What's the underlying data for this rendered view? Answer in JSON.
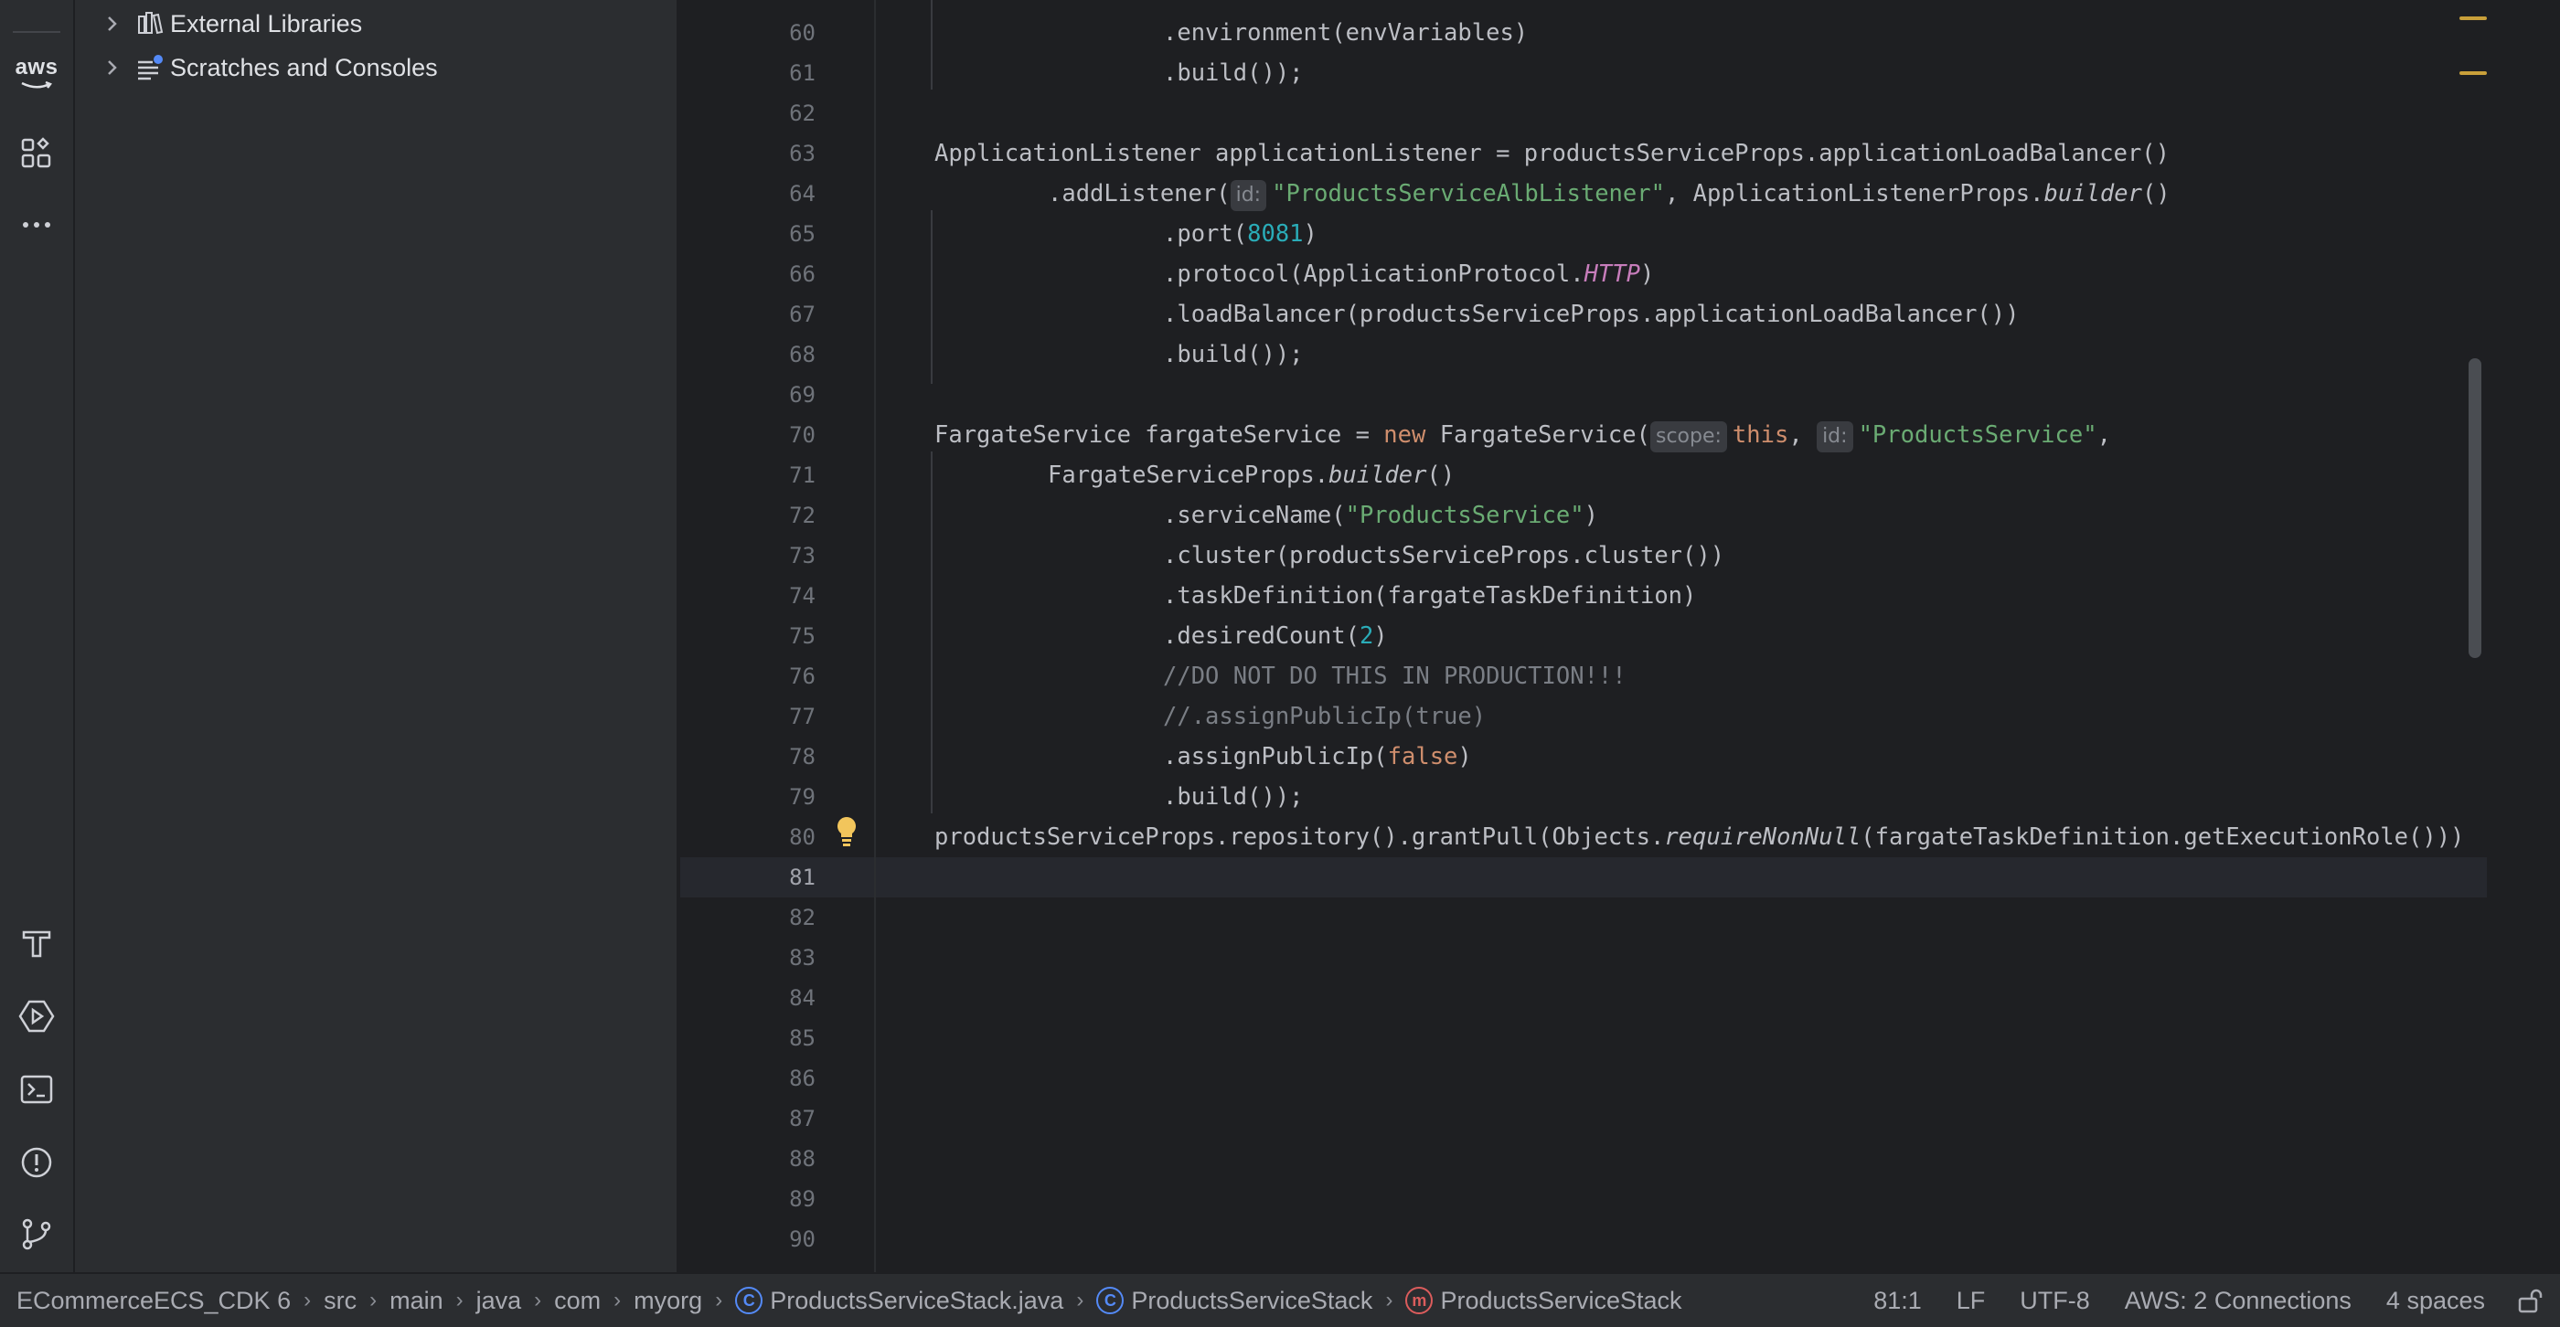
{
  "activity_bar": {
    "aws_label": "aws",
    "top_icons": [
      "structure-icon",
      "more-icon"
    ],
    "bottom_icons": [
      "build-icon",
      "services-icon",
      "terminal-icon",
      "problems-icon",
      "git-icon"
    ]
  },
  "project_tree": {
    "items": [
      {
        "label": "External Libraries",
        "icon": "library-icon"
      },
      {
        "label": "Scratches and Consoles",
        "icon": "scratches-icon"
      }
    ]
  },
  "editor": {
    "current_line": 81,
    "line_numbers": [
      "60",
      "61",
      "62",
      "63",
      "64",
      "65",
      "66",
      "67",
      "68",
      "69",
      "70",
      "71",
      "72",
      "73",
      "74",
      "75",
      "76",
      "77",
      "78",
      "79",
      "80",
      "81",
      "82",
      "83",
      "84",
      "85",
      "86",
      "87",
      "88",
      "89",
      "90"
    ],
    "code": {
      "l60": ".environment(envVariables)",
      "l61": ".build());",
      "l63": "ApplicationListener applicationListener = productsServiceProps.applicationLoadBalancer()",
      "l64_a": ".addListener(",
      "l64_hint": "id:",
      "l64_str": "\"ProductsServiceAlbListener\"",
      "l64_b": ", ApplicationListenerProps.",
      "l64_it": "builder",
      "l64_c": "()",
      "l65_a": ".port(",
      "l65_num": "8081",
      "l65_b": ")",
      "l66_a": ".protocol(ApplicationProtocol.",
      "l66_const": "HTTP",
      "l66_b": ")",
      "l67": ".loadBalancer(productsServiceProps.applicationLoadBalancer())",
      "l68": ".build());",
      "l70_a": "FargateService fargateService = ",
      "l70_kw": "new",
      "l70_b": " FargateService(",
      "l70_hint1": "scope:",
      "l70_this": "this",
      "l70_c": ", ",
      "l70_hint2": "id:",
      "l70_str": "\"ProductsService\"",
      "l70_d": ",",
      "l71_a": "FargateServiceProps.",
      "l71_it": "builder",
      "l71_b": "()",
      "l72_a": ".serviceName(",
      "l72_str": "\"ProductsService\"",
      "l72_b": ")",
      "l73": ".cluster(productsServiceProps.cluster())",
      "l74": ".taskDefinition(fargateTaskDefinition)",
      "l75_a": ".desiredCount(",
      "l75_num": "2",
      "l75_b": ")",
      "l76": "//DO NOT DO THIS IN PRODUCTION!!!",
      "l77": "//.assignPublicIp(true)",
      "l78_a": ".assignPublicIp(",
      "l78_kw": "false",
      "l78_b": ")",
      "l79": ".build());",
      "l80_a": "productsServiceProps.repository().grantPull(Objects.",
      "l80_it": "requireNonNull",
      "l80_b": "(fargateTaskDefinition.getExecutionRole()))"
    }
  },
  "status_bar": {
    "breadcrumbs": [
      {
        "label": "ECommerceECS_CDK 6",
        "icon": ""
      },
      {
        "label": "src",
        "icon": ""
      },
      {
        "label": "main",
        "icon": ""
      },
      {
        "label": "java",
        "icon": ""
      },
      {
        "label": "com",
        "icon": ""
      },
      {
        "label": "myorg",
        "icon": ""
      },
      {
        "label": "ProductsServiceStack.java",
        "icon": "class-icon"
      },
      {
        "label": "ProductsServiceStack",
        "icon": "class-icon"
      },
      {
        "label": "ProductsServiceStack",
        "icon": "method-icon"
      }
    ],
    "position": "81:1",
    "line_sep": "LF",
    "encoding": "UTF-8",
    "aws": "AWS: 2 Connections",
    "indent": "4 spaces"
  },
  "colors": {
    "string": "#6aab73",
    "number": "#2aacb8",
    "keyword": "#cf8e6d",
    "constant": "#c77dbb",
    "comment": "#7a7e85"
  }
}
